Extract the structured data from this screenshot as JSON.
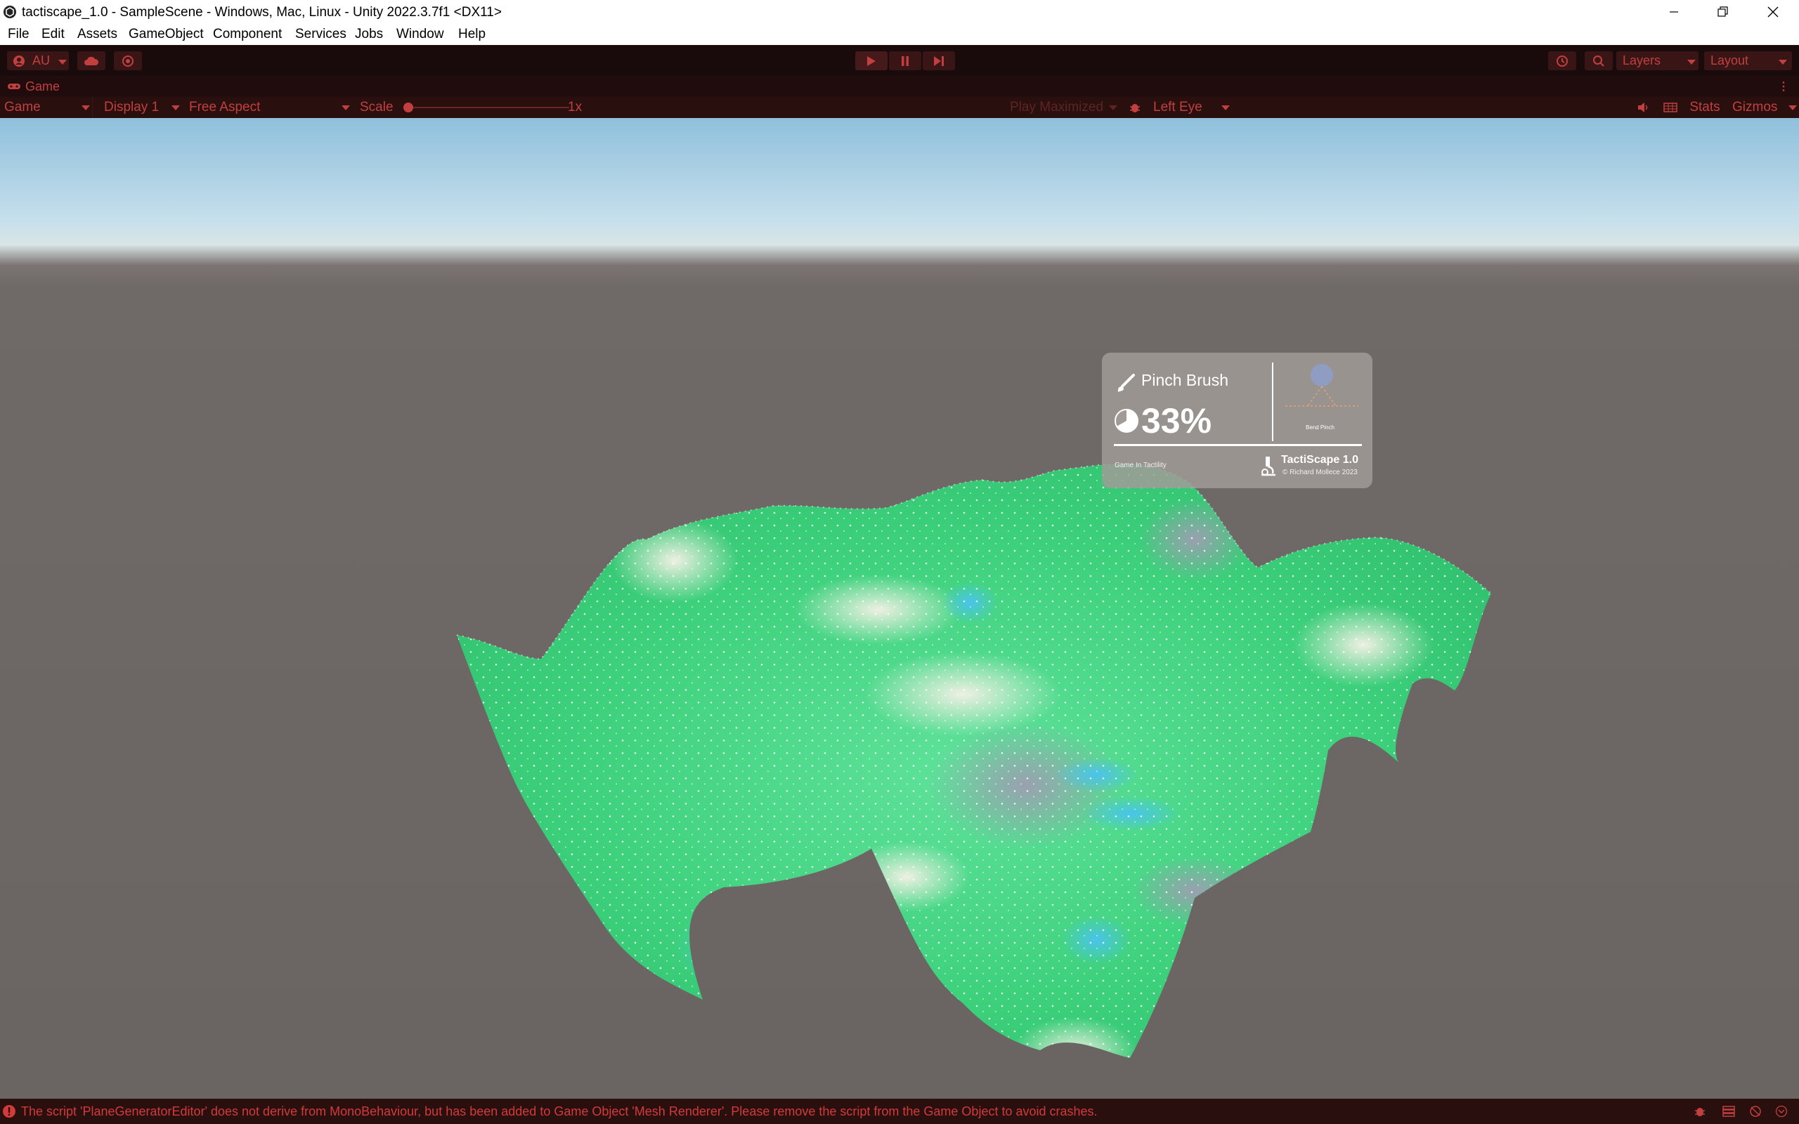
{
  "window": {
    "title": "tactiscape_1.0 - SampleScene - Windows, Mac, Linux - Unity 2022.3.7f1 <DX11>",
    "controls": {
      "minimize": "—",
      "maximize": "❐",
      "close": "✕"
    }
  },
  "menu": {
    "items": [
      "File",
      "Edit",
      "Assets",
      "GameObject",
      "Component",
      "Services",
      "Jobs",
      "Window",
      "Help"
    ]
  },
  "toolbar": {
    "account_label": "AU",
    "layers_label": "Layers",
    "layout_label": "Layout"
  },
  "game_tab": {
    "label": "Game"
  },
  "game_bar": {
    "view_mode": "Game",
    "display": "Display 1",
    "aspect": "Free Aspect",
    "scale_label": "Scale",
    "scale_value": "1x",
    "play_mode": "Play Maximized",
    "eye": "Left Eye",
    "stats_label": "Stats",
    "gizmos_label": "Gizmos"
  },
  "hud": {
    "brush_name": "Pinch Brush",
    "percentage": "33%",
    "mode_label": "Bend Pinch",
    "caption": "Game In Tactility",
    "brand": "TactiScape 1.0",
    "copyright": "© Richard Mollece 2023"
  },
  "status": {
    "message": "The script 'PlaneGeneratorEditor' does not derive from MonoBehaviour, but has been added to Game Object 'Mesh Renderer'. Please remove the script from the Game Object to avoid crashes."
  },
  "colors": {
    "accent": "#c1403f",
    "toolbar_bg": "#190b0b",
    "terrain_green": "#3fd881",
    "terrain_blue": "#3cbfe6",
    "ground": "#676160"
  }
}
